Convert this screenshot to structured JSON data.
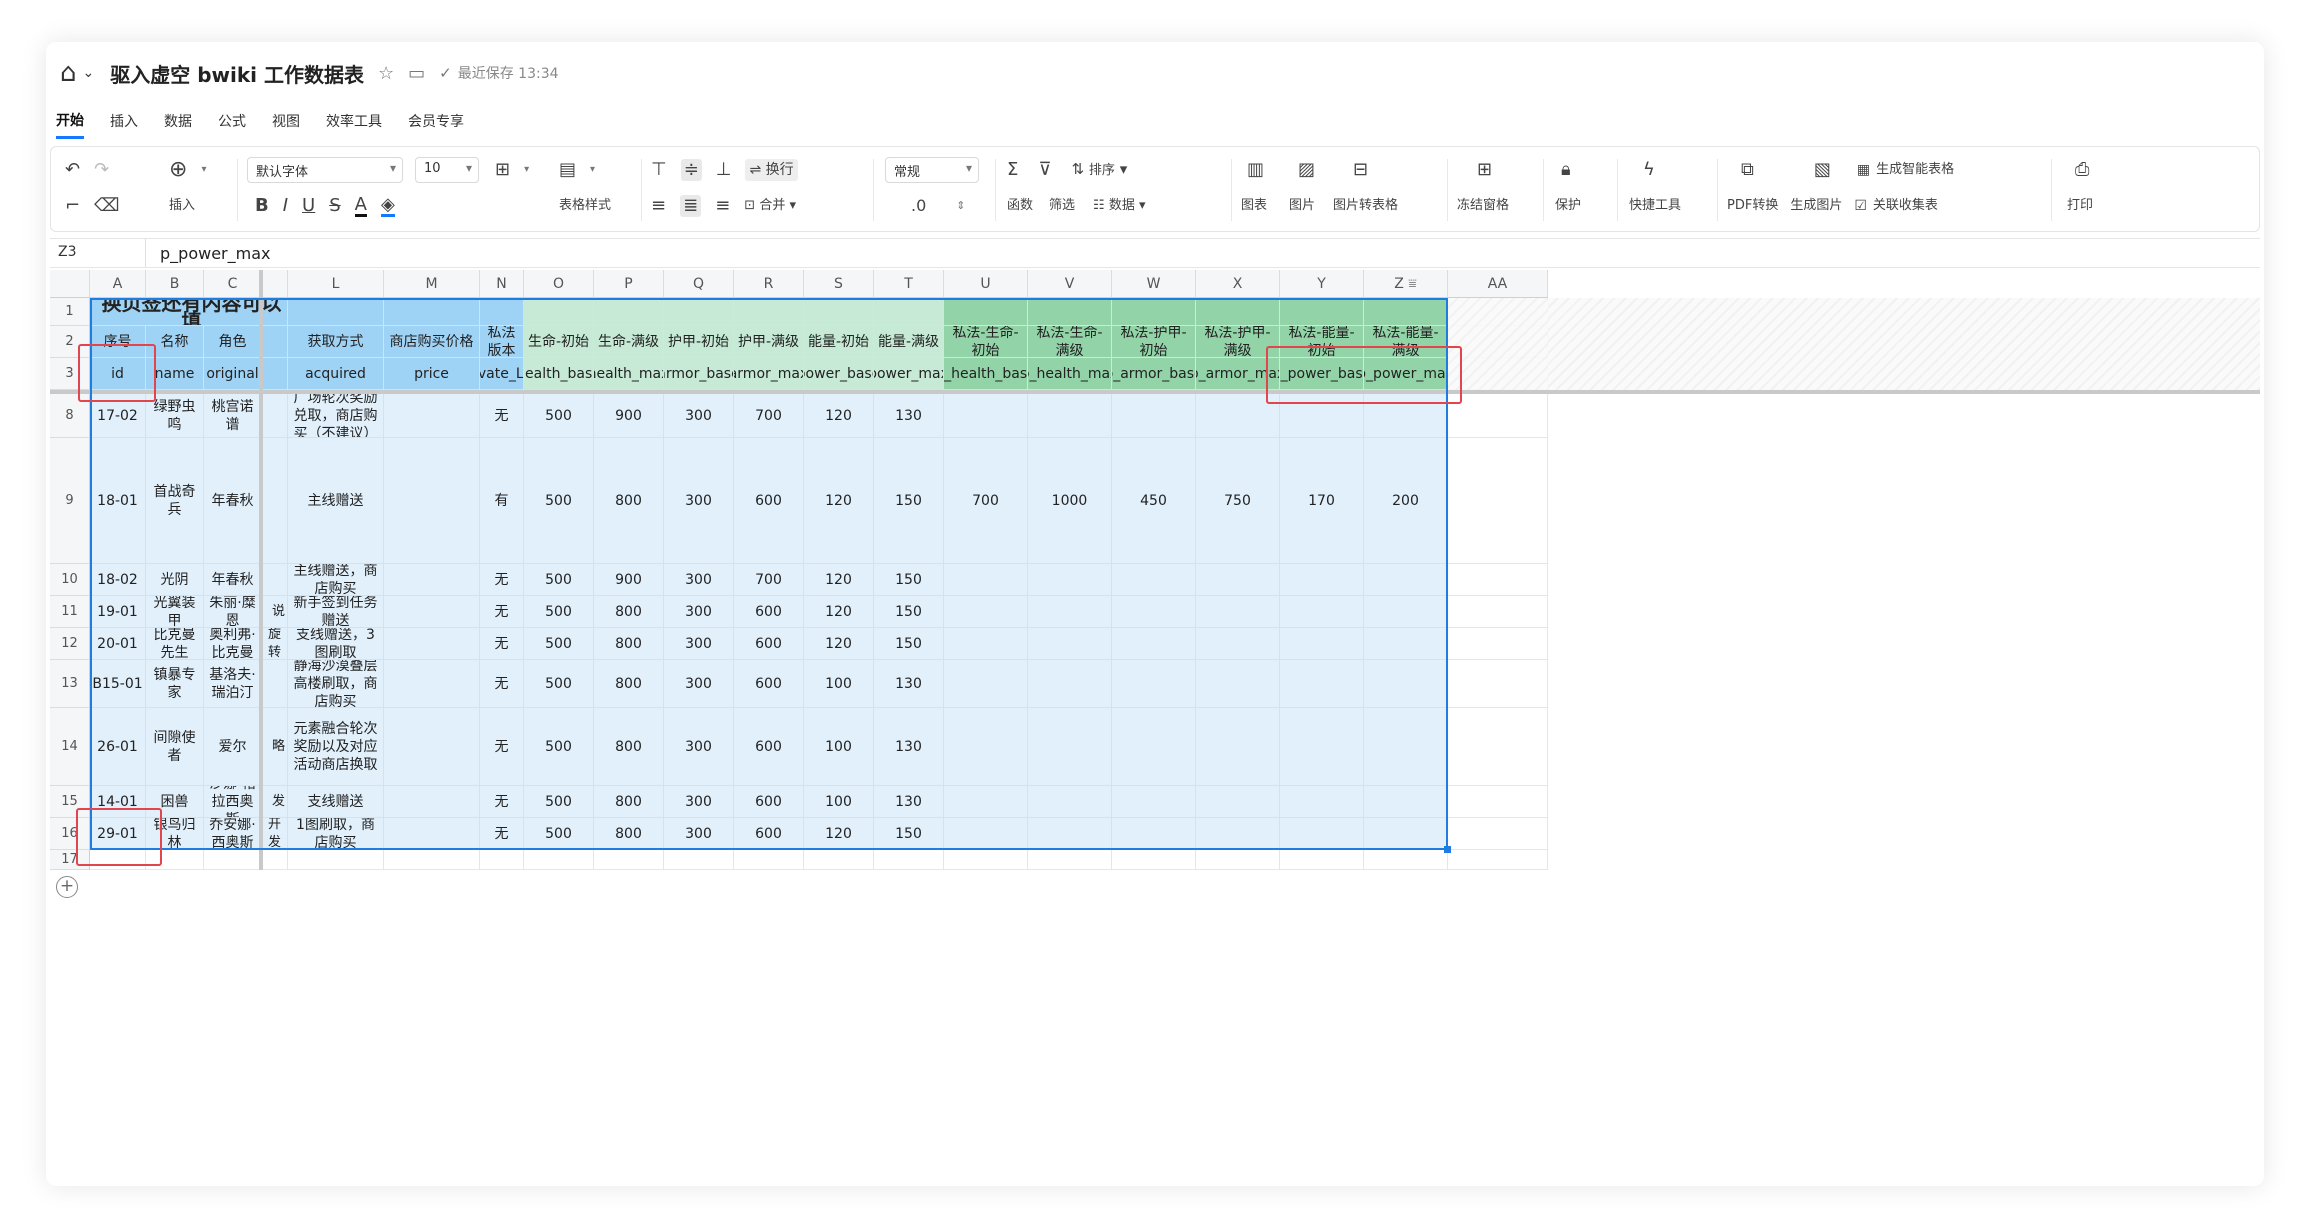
{
  "app": {
    "title": "驱入虚空 bwiki 工作数据表",
    "saved_status": "最近保存 13:34"
  },
  "menu": [
    "开始",
    "插入",
    "数据",
    "公式",
    "视图",
    "效率工具",
    "会员专享"
  ],
  "toolbar": {
    "insert": "插入",
    "font": "默认字体",
    "size": "10",
    "table_style": "表格样式",
    "wrap": "换行",
    "merge": "合并",
    "number_format": "常规",
    "decimal": ".0",
    "func": "函数",
    "filter": "筛选",
    "sort": "排序",
    "data": "数据",
    "chart": "图表",
    "image": "图片",
    "img_to_table": "图片转表格",
    "freeze": "冻结窗格",
    "protect": "保护",
    "quick_tools": "快捷工具",
    "pdf": "PDF转换",
    "gen_image": "生成图片",
    "smart_table": "生成智能表格",
    "linked_collect": "关联收集表",
    "print": "打印"
  },
  "formula_bar": {
    "cell_ref": "Z3",
    "content": "p_power_max"
  },
  "sheet": {
    "columns": [
      "A",
      "B",
      "C",
      "L",
      "M",
      "N",
      "O",
      "P",
      "Q",
      "R",
      "S",
      "T",
      "U",
      "V",
      "W",
      "X",
      "Y",
      "Z",
      "AA"
    ],
    "title_cell": "换页签还有内容可以填",
    "headers_cn": [
      "序号",
      "名称",
      "角色",
      "获取方式",
      "商店购买价格",
      "私法版本",
      "生命-初始",
      "生命-满级",
      "护甲-初始",
      "护甲-满级",
      "能量-初始",
      "能量-满级",
      "私法-生命-初始",
      "私法-生命-满级",
      "私法-护甲-初始",
      "私法-护甲-满级",
      "私法-能量-初始",
      "私法-能量-满级"
    ],
    "headers_en": [
      "id",
      "name",
      "original",
      "acquired",
      "price",
      "private_Law",
      "health_base",
      "health_max",
      "armor_base",
      "armor_max",
      "power_base",
      "power_max",
      "p_health_base",
      "p_health_max",
      "p_armor_base",
      "p_armor_max",
      "p_power_base",
      "p_power_max"
    ],
    "rows": [
      {
        "num": "8",
        "cells": [
          "17-02",
          "绿野虫鸣",
          "桃宫诺谱",
          "",
          "广场轮次奖励兑取，商店购买（不建议）",
          "",
          "无",
          "500",
          "900",
          "300",
          "700",
          "120",
          "130",
          "",
          "",
          "",
          "",
          "",
          ""
        ]
      },
      {
        "num": "9",
        "cells": [
          "18-01",
          "首战奇兵",
          "年春秋",
          "",
          "主线赠送",
          "",
          "有",
          "500",
          "800",
          "300",
          "600",
          "120",
          "150",
          "700",
          "1000",
          "450",
          "750",
          "170",
          "200"
        ]
      },
      {
        "num": "10",
        "cells": [
          "18-02",
          "光阴",
          "年春秋",
          "",
          "主线赠送，商店购买",
          "",
          "无",
          "500",
          "900",
          "300",
          "700",
          "120",
          "150",
          "",
          "",
          "",
          "",
          "",
          ""
        ]
      },
      {
        "num": "11",
        "cells": [
          "19-01",
          "光翼装甲",
          "朱丽·糜恩",
          "说",
          "新手签到任务赠送",
          "",
          "无",
          "500",
          "800",
          "300",
          "600",
          "120",
          "150",
          "",
          "",
          "",
          "",
          "",
          ""
        ]
      },
      {
        "num": "12",
        "cells": [
          "20-01",
          "比克曼先生",
          "奥利弗·比克曼",
          "旋转",
          "支线赠送，3图刷取",
          "",
          "无",
          "500",
          "800",
          "300",
          "600",
          "120",
          "150",
          "",
          "",
          "",
          "",
          "",
          ""
        ]
      },
      {
        "num": "13",
        "cells": [
          "B15-01",
          "镇暴专家",
          "基洛夫·瑞泊汀",
          "",
          "静海沙漠叠层高楼刷取，商店购买",
          "",
          "无",
          "500",
          "800",
          "300",
          "600",
          "100",
          "130",
          "",
          "",
          "",
          "",
          "",
          ""
        ]
      },
      {
        "num": "14",
        "cells": [
          "26-01",
          "间隙使者",
          "爱尔",
          "略",
          "元素融合轮次奖励以及对应活动商店换取",
          "",
          "无",
          "500",
          "800",
          "300",
          "600",
          "100",
          "130",
          "",
          "",
          "",
          "",
          "",
          ""
        ]
      },
      {
        "num": "15",
        "cells": [
          "14-01",
          "困兽",
          "沙娜·帕拉西奥斯",
          "发",
          "支线赠送",
          "",
          "无",
          "500",
          "800",
          "300",
          "600",
          "100",
          "130",
          "",
          "",
          "",
          "",
          "",
          ""
        ]
      },
      {
        "num": "16",
        "cells": [
          "29-01",
          "银鸟归林",
          "乔安娜·西奥斯",
          "开发",
          "1图刷取，商店购买",
          "",
          "无",
          "500",
          "800",
          "300",
          "600",
          "120",
          "150",
          "",
          "",
          "",
          "",
          "",
          ""
        ]
      }
    ],
    "row_numbers": [
      "1",
      "2",
      "3",
      "17"
    ]
  },
  "colors": {
    "header_blue": "#9fd3f6",
    "header_light_green": "#c6ead5",
    "header_dark_green": "#92d3a8",
    "body_blue": "#e1f0fb",
    "selection": "#1f7ce0",
    "highlight_red": "#e0464e"
  }
}
